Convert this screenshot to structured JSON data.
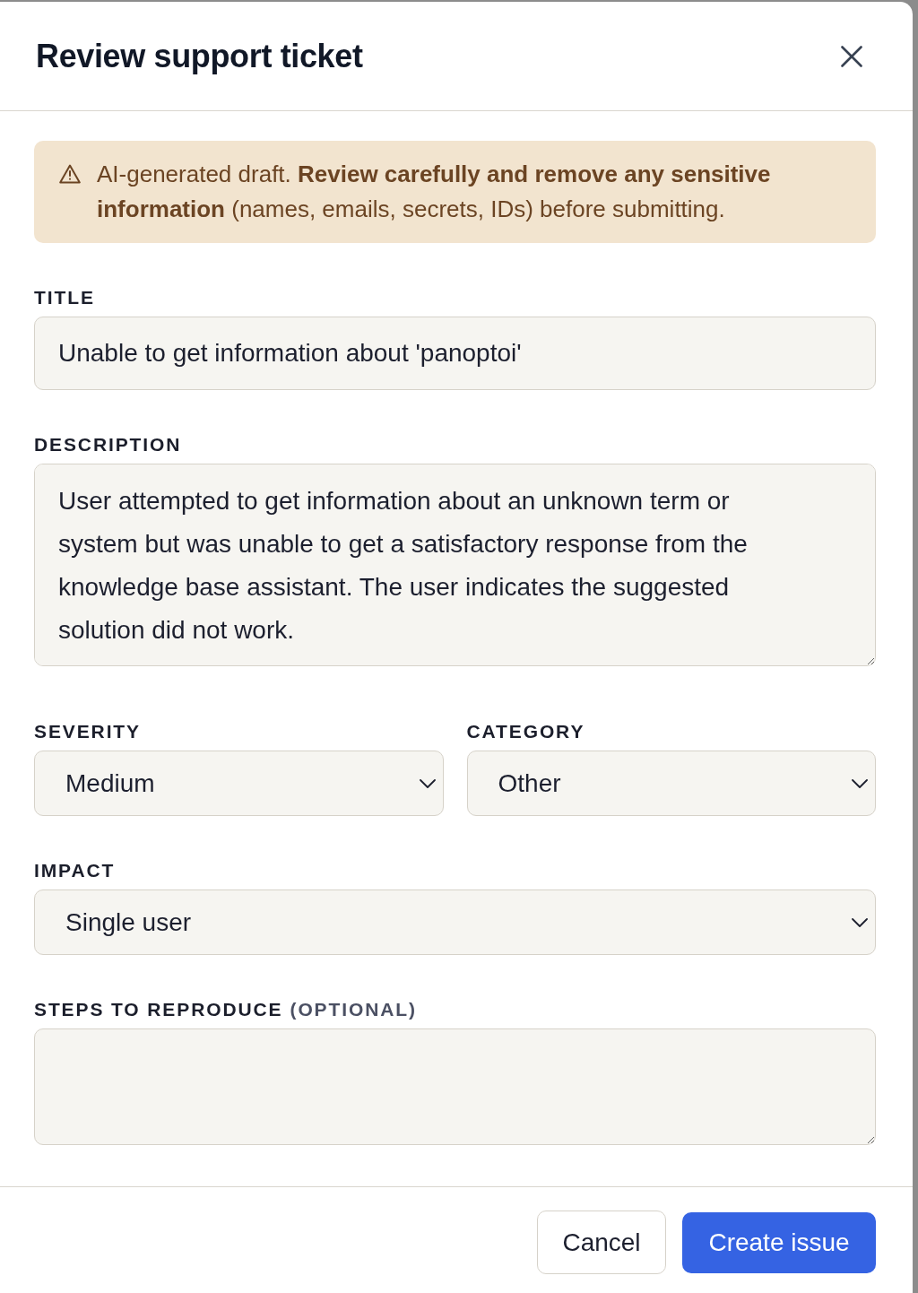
{
  "dialog": {
    "title": "Review support ticket"
  },
  "alert": {
    "text": "AI-generated draft. **Review carefully and remove any sensitive information** (names, emails, secrets, IDs) before submitting."
  },
  "form": [
    {
      "kind": "input",
      "label": "TITLE",
      "value": "Unable to get information about 'panoptoi'"
    },
    {
      "kind": "textarea",
      "label": "DESCRIPTION",
      "value": "User attempted to get information about an unknown term or system but was unable to get a satisfactory response from the knowledge base assistant. The user indicates the suggested solution did not work."
    },
    {
      "kind": "row",
      "fields": [
        {
          "kind": "select",
          "label": "SEVERITY",
          "value": "Medium"
        },
        {
          "kind": "select",
          "label": "CATEGORY",
          "value": "Other"
        }
      ]
    },
    {
      "kind": "select",
      "label": "IMPACT",
      "value": "Single user"
    },
    {
      "kind": "textarea",
      "label": "STEPS TO REPRODUCE",
      "hint": "(OPTIONAL)"
    }
  ],
  "buttons": [
    {
      "kind": "secondary",
      "label": "Cancel"
    },
    {
      "kind": "primary",
      "label": "Create issue"
    }
  ]
}
